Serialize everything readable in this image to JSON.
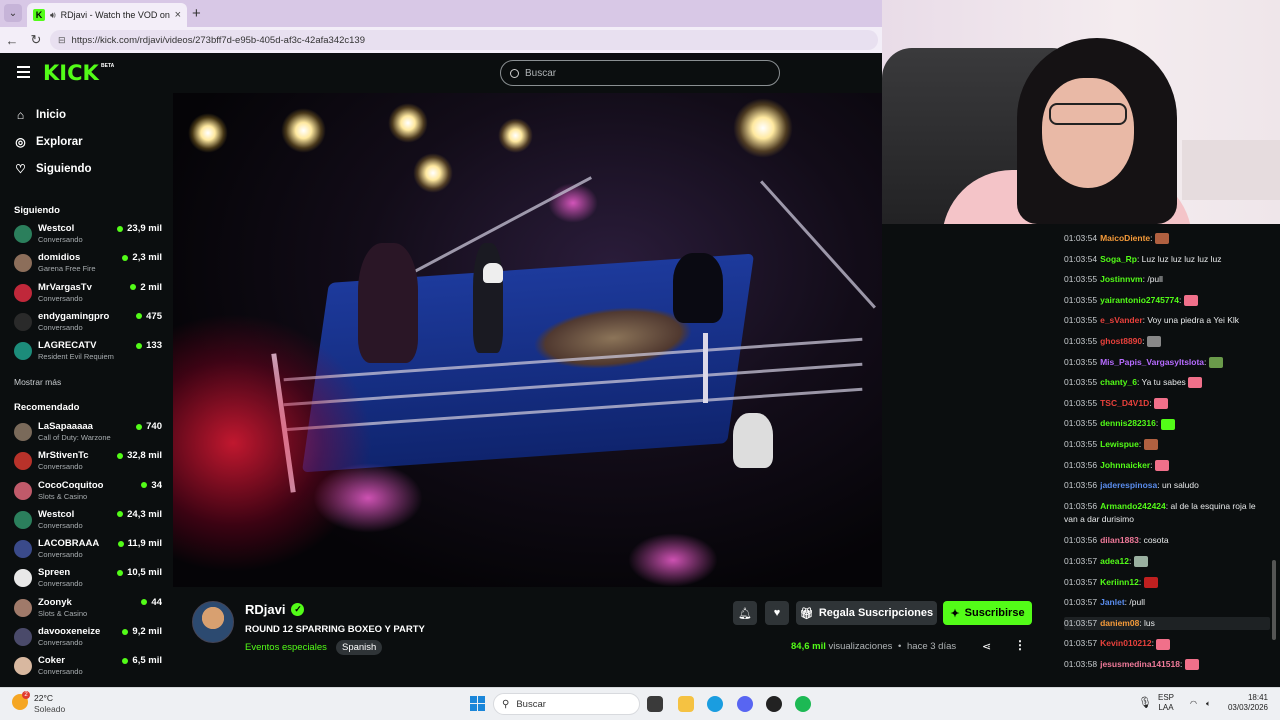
{
  "browser": {
    "tab_title": "RDjavi - Watch the VOD on Ki",
    "url": "https://kick.com/rdjavi/videos/273bff7d-e95b-405d-af3c-42afa342c139"
  },
  "header": {
    "logo": "KICK",
    "logo_badge": "BETA",
    "search_placeholder": "Buscar"
  },
  "sidebar": {
    "nav": [
      {
        "label": "Inicio",
        "icon": "home-icon"
      },
      {
        "label": "Explorar",
        "icon": "compass-icon"
      },
      {
        "label": "Siguiendo",
        "icon": "heart-icon"
      }
    ],
    "following_title": "Siguiendo",
    "following": [
      {
        "name": "Westcol",
        "category": "Conversando",
        "viewers": "23,9 mil",
        "color": "#2b7f5c"
      },
      {
        "name": "domidios",
        "category": "Garena Free Fire",
        "viewers": "2,3 mil",
        "color": "#8c6e5a"
      },
      {
        "name": "MrVargasTv",
        "category": "Conversando",
        "viewers": "2 mil",
        "color": "#c0283a"
      },
      {
        "name": "endygamingpro",
        "category": "Conversando",
        "viewers": "475",
        "color": "#2a2a2a"
      },
      {
        "name": "LAGRECATV",
        "category": "Resident Evil Requiem",
        "viewers": "133",
        "color": "#1c8c7a"
      }
    ],
    "show_more": "Mostrar más",
    "recommended_title": "Recomendado",
    "recommended": [
      {
        "name": "LaSapaaaaa",
        "category": "Call of Duty: Warzone",
        "viewers": "740",
        "color": "#7a6a5a"
      },
      {
        "name": "MrStivenTc",
        "category": "Conversando",
        "viewers": "32,8 mil",
        "color": "#b8322a"
      },
      {
        "name": "CocoCoquitoo",
        "category": "Slots & Casino",
        "viewers": "34",
        "color": "#c05a6a"
      },
      {
        "name": "Westcol",
        "category": "Conversando",
        "viewers": "24,3 mil",
        "color": "#2b7f5c"
      },
      {
        "name": "LACOBRAAA",
        "category": "Conversando",
        "viewers": "11,9 mil",
        "color": "#3a4a8a"
      },
      {
        "name": "Spreen",
        "category": "Conversando",
        "viewers": "10,5 mil",
        "color": "#e8e8e8"
      },
      {
        "name": "Zoonyk",
        "category": "Slots & Casino",
        "viewers": "44",
        "color": "#a07a6a"
      },
      {
        "name": "davooxeneize",
        "category": "Conversando",
        "viewers": "9,2 mil",
        "color": "#4a4a6a"
      },
      {
        "name": "Coker",
        "category": "Conversando",
        "viewers": "6,5 mil",
        "color": "#d8b8a0"
      }
    ]
  },
  "channel": {
    "name": "RDjavi",
    "title": "ROUND 12 SPARRING  BOXEO Y PARTY",
    "category": "Eventos especiales",
    "language": "Spanish",
    "gift_label": "Regala Suscripciones",
    "subscribe_label": "Suscribirse",
    "views_number": "84,6 mil",
    "views_label": "visualizaciones",
    "separator": "•",
    "age": "hace 3 días"
  },
  "chat": [
    {
      "ts": "01:03:54",
      "user": "MaicoDiente",
      "color": "#f59b3a",
      "text": "",
      "emote": "#b06040"
    },
    {
      "ts": "01:03:54",
      "user": "Soga_Rp",
      "color": "#53fc18",
      "text": "Luz luz luz luz luz luz",
      "emote": ""
    },
    {
      "ts": "01:03:55",
      "user": "Jostinnvm",
      "color": "#53fc18",
      "text": "/pull",
      "emote": ""
    },
    {
      "ts": "01:03:55",
      "user": "yairantonio2745774",
      "color": "#53fc18",
      "text": "",
      "emote": "#f0708a"
    },
    {
      "ts": "01:03:55",
      "user": "e_sVander",
      "color": "#e8413c",
      "text": "Voy una piedra a Yei Klk",
      "emote": ""
    },
    {
      "ts": "01:03:55",
      "user": "ghost8890",
      "color": "#e8413c",
      "text": "",
      "emote": "#888888"
    },
    {
      "ts": "01:03:55",
      "user": "Mis_Papis_VargasyItslota",
      "color": "#b66bff",
      "text": "",
      "emote": "#6a9a4a"
    },
    {
      "ts": "01:03:55",
      "user": "chanty_6",
      "color": "#53fc18",
      "text": "Ya tu sabes",
      "emote": "#f0708a"
    },
    {
      "ts": "01:03:55",
      "user": "TSC_D4V1D",
      "color": "#e8413c",
      "text": "",
      "emote": "#f0708a"
    },
    {
      "ts": "01:03:55",
      "user": "dennis282316",
      "color": "#53fc18",
      "text": "",
      "emote": "#53fc18"
    },
    {
      "ts": "01:03:55",
      "user": "Lewispue",
      "color": "#53fc18",
      "text": "",
      "emote": "#b06040"
    },
    {
      "ts": "01:03:56",
      "user": "Johnnaicker",
      "color": "#53fc18",
      "text": "",
      "emote": "#f0708a"
    },
    {
      "ts": "01:03:56",
      "user": "jaderespinosa",
      "color": "#5a8dee",
      "text": "un saludo",
      "emote": ""
    },
    {
      "ts": "01:03:56",
      "user": "Armando242424",
      "color": "#53fc18",
      "text": "al de la esquina roja le van a dar durisimo",
      "emote": ""
    },
    {
      "ts": "01:03:56",
      "user": "dilan1883",
      "color": "#f07a9a",
      "text": "cosota",
      "emote": ""
    },
    {
      "ts": "01:03:57",
      "user": "adea12",
      "color": "#53fc18",
      "text": "",
      "emote": "#9ab0a0"
    },
    {
      "ts": "01:03:57",
      "user": "Keriinn12",
      "color": "#53fc18",
      "text": "",
      "emote": "#c02020"
    },
    {
      "ts": "01:03:57",
      "user": "Janlet",
      "color": "#5a8dee",
      "text": "/pull",
      "emote": ""
    },
    {
      "ts": "01:03:57",
      "user": "daniem08",
      "color": "#f59b3a",
      "text": "lus",
      "emote": ""
    },
    {
      "ts": "01:03:57",
      "user": "Kevin010212",
      "color": "#e8413c",
      "text": "",
      "emote": "#f0708a"
    },
    {
      "ts": "01:03:58",
      "user": "jesusmedina141518",
      "color": "#f07a9a",
      "text": "",
      "emote": "#f0708a"
    }
  ],
  "taskbar": {
    "temperature": "22°C",
    "condition": "Soleado",
    "weather_badge": "2",
    "search_placeholder": "Buscar",
    "lang_top": "ESP",
    "lang_bottom": "LAA",
    "time": "18:41",
    "date": "03/03/2026"
  }
}
